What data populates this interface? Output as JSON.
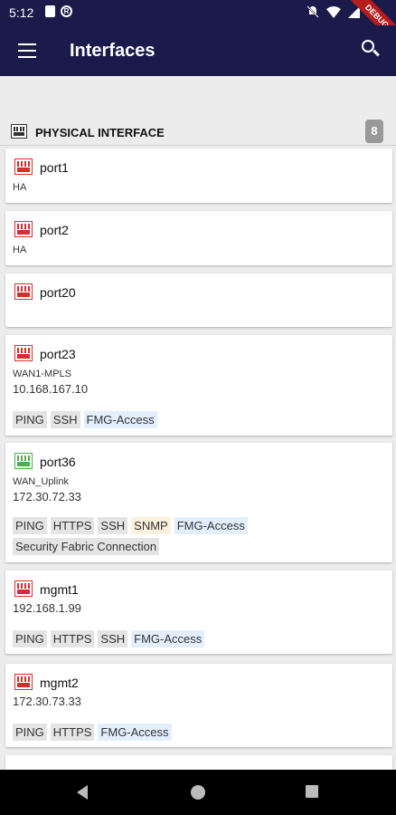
{
  "status_bar": {
    "time": "5:12",
    "debug_label": "DEBUG"
  },
  "app_bar": {
    "title": "Interfaces"
  },
  "section": {
    "title": "PHYSICAL INTERFACE",
    "count": "8",
    "icon": "port-icon"
  },
  "colors": {
    "app_bar_bg": "#1b1b4b",
    "port_down": "#d32f2f",
    "port_up": "#4caf50"
  },
  "ports": [
    {
      "name": "port1",
      "alias": "HA",
      "ip": "",
      "status": "down",
      "tags": []
    },
    {
      "name": "port2",
      "alias": "HA",
      "ip": "",
      "status": "down",
      "tags": []
    },
    {
      "name": "port20",
      "alias": "",
      "ip": "",
      "status": "down",
      "tags": []
    },
    {
      "name": "port23",
      "alias": "WAN1-MPLS",
      "ip": "10.168.167.10",
      "status": "down",
      "tags": [
        "PING",
        "SSH",
        "FMG-Access"
      ]
    },
    {
      "name": "port36",
      "alias": "WAN_Uplink",
      "ip": "172.30.72.33",
      "status": "up",
      "tags": [
        "PING",
        "HTTPS",
        "SSH",
        "SNMP",
        "FMG-Access",
        "Security Fabric Connection"
      ]
    },
    {
      "name": "mgmt1",
      "alias": "",
      "ip": "192.168.1.99",
      "status": "down",
      "tags": [
        "PING",
        "HTTPS",
        "SSH",
        "FMG-Access"
      ]
    },
    {
      "name": "mgmt2",
      "alias": "",
      "ip": "172.30.73.33",
      "status": "down",
      "tags": [
        "PING",
        "HTTPS",
        "FMG-Access"
      ]
    }
  ]
}
